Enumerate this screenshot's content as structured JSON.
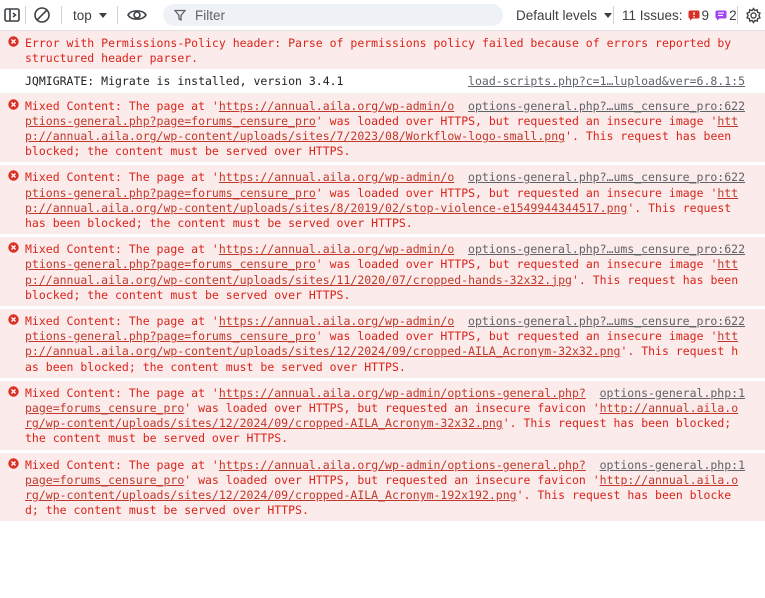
{
  "toolbar": {
    "context": "top",
    "filter_placeholder": "Filter",
    "levels_label": "Default levels",
    "issues_label": "11 Issues:",
    "issues_errors": "9",
    "issues_messages": "2"
  },
  "messages": [
    {
      "level": "error",
      "before": "Error with Permissions-Policy header: Parse of permissions policy failed because of errors reported by structured header parser.",
      "source": "",
      "link1": "",
      "middle": "",
      "link2": "",
      "after": ""
    },
    {
      "level": "info",
      "before": "JQMIGRATE: Migrate is installed, version 3.4.1",
      "source": "load-scripts.php?c=1…lupload&ver=6.8.1:5",
      "link1": "",
      "middle": "",
      "link2": "",
      "after": ""
    },
    {
      "level": "error",
      "before": "Mixed Content: The page at '",
      "source": "options-general.php?…ums_censure_pro:622",
      "link1": "https://annual.aila.org/wp-admin/options-general.php?page=forums_censure_pro",
      "middle": "' was loaded over HTTPS, but requested an insecure image '",
      "link2": "http://annual.aila.org/wp-content/uploads/sites/7/2023/08/Workflow-logo-small.png",
      "after": "'. This request has been blocked; the content must be served over HTTPS."
    },
    {
      "level": "error",
      "before": "Mixed Content: The page at '",
      "source": "options-general.php?…ums_censure_pro:622",
      "link1": "https://annual.aila.org/wp-admin/options-general.php?page=forums_censure_pro",
      "middle": "' was loaded over HTTPS, but requested an insecure image '",
      "link2": "http://annual.aila.org/wp-content/uploads/sites/8/2019/02/stop-violence-e1549944344517.png",
      "after": "'. This request has been blocked; the content must be served over HTTPS."
    },
    {
      "level": "error",
      "before": "Mixed Content: The page at '",
      "source": "options-general.php?…ums_censure_pro:622",
      "link1": "https://annual.aila.org/wp-admin/options-general.php?page=forums_censure_pro",
      "middle": "' was loaded over HTTPS, but requested an insecure image '",
      "link2": "http://annual.aila.org/wp-content/uploads/sites/11/2020/07/cropped-hands-32x32.jpg",
      "after": "'. This request has been blocked; the content must be served over HTTPS."
    },
    {
      "level": "error",
      "before": "Mixed Content: The page at '",
      "source": "options-general.php?…ums_censure_pro:622",
      "link1": "https://annual.aila.org/wp-admin/options-general.php?page=forums_censure_pro",
      "middle": "' was loaded over HTTPS, but requested an insecure image '",
      "link2": "http://annual.aila.org/wp-content/uploads/sites/12/2024/09/cropped-AILA_Acronym-32x32.png",
      "after": "'. This request has been blocked; the content must be served over HTTPS."
    },
    {
      "level": "error",
      "before": "Mixed Content: The page at '",
      "source": "options-general.php:1",
      "link1": "https://annual.aila.org/wp-admin/options-general.php?page=forums_censure_pro",
      "middle": "' was loaded over HTTPS, but requested an insecure favicon '",
      "link2": "http://annual.aila.org/wp-content/uploads/sites/12/2024/09/cropped-AILA_Acronym-32x32.png",
      "after": "'. This request has been blocked; the content must be served over HTTPS."
    },
    {
      "level": "error",
      "before": "Mixed Content: The page at '",
      "source": "options-general.php:1",
      "link1": "https://annual.aila.org/wp-admin/options-general.php?page=forums_censure_pro",
      "middle": "' was loaded over HTTPS, but requested an insecure favicon '",
      "link2": "http://annual.aila.org/wp-content/uploads/sites/12/2024/09/cropped-AILA_Acronym-192x192.png",
      "after": "'. This request has been blocked; the content must be served over HTTPS."
    }
  ],
  "colors": {
    "error_text": "#d9241a",
    "error_background": "#fcebeb",
    "error_icon": "#d93025",
    "message_icon": "#a142f4"
  },
  "icons": [
    "sidebar-toggle-icon",
    "clear-console-icon",
    "dropdown-caret-icon",
    "eye-icon",
    "filter-icon",
    "error-circle-icon",
    "message-icon",
    "gear-icon"
  ]
}
